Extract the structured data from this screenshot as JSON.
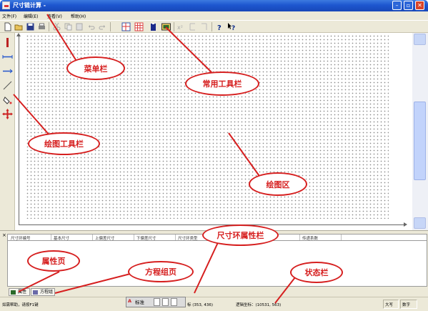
{
  "window": {
    "title": "尺寸链计算 -"
  },
  "menu": {
    "items": [
      "文件(F)",
      "编辑(E)",
      "查看(V)",
      "帮助(H)"
    ]
  },
  "toolbar": {
    "icons": [
      "new-file-icon",
      "open-file-icon",
      "save-icon",
      "print-icon",
      "cut-icon",
      "copy-icon",
      "paste-icon",
      "undo-icon",
      "redo-icon",
      "grid-view-icon",
      "table-view-icon",
      "clipboard-icon",
      "calculator-icon",
      "help-icon",
      "context-help-icon"
    ]
  },
  "draw_tools": {
    "icons": [
      "vertical-line-icon",
      "horizontal-ring-icon",
      "dimension-line-icon",
      "angle-line-icon",
      "fill-icon",
      "move-icon"
    ]
  },
  "attribute_table": {
    "columns": [
      "尺寸环编号",
      "基本尺寸",
      "上偏差尺寸",
      "下偏差尺寸",
      "尺寸环类型",
      "",
      "属性",
      "传递系数"
    ]
  },
  "tabs": [
    "属性",
    "方程组"
  ],
  "statusbar": {
    "help": "如需帮助，请按F1键",
    "coord_partial": "标 (353, 436)",
    "logic_coord": "逻辑坐标：(10531, 563)",
    "caps": "大写",
    "num": "数字"
  },
  "ime": {
    "label": "标准"
  },
  "annotations": {
    "menubar": "菜单栏",
    "common_toolbar": "常用工具栏",
    "draw_toolbar": "绘图工具栏",
    "draw_area": "绘图区",
    "ring_attr": "尺寸环属性栏",
    "attr_page": "属性页",
    "eq_page": "方程组页",
    "statusbar": "状态栏"
  },
  "colors": {
    "callout": "#d61f1f",
    "titlebar": "#1d56cf",
    "chrome": "#ece9d8"
  }
}
